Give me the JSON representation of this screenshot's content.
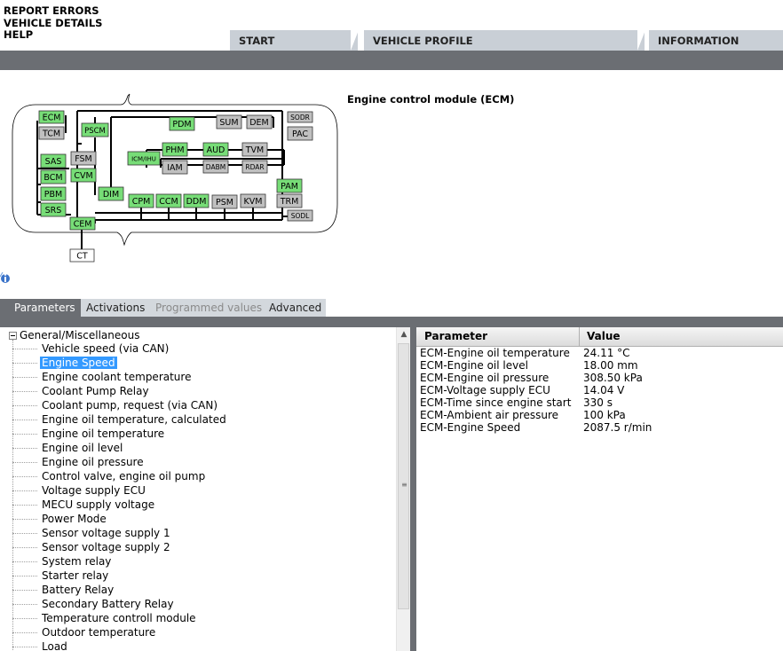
{
  "menu": {
    "report_errors": "REPORT ERRORS",
    "vehicle_details": "VEHICLE DETAILS",
    "help": "HELP"
  },
  "tabs": [
    {
      "label": "START"
    },
    {
      "label": "VEHICLE PROFILE"
    },
    {
      "label": "INFORMATION"
    }
  ],
  "module_title": "Engine control module (ECM)",
  "colors": {
    "green": "#77dd77",
    "gray": "#c0c0c0",
    "navbar": "#6b6e73",
    "tab": "#c9cfd6",
    "selected": "#3399ff"
  },
  "modules": {
    "ecm": "ECM",
    "tcm": "TCM",
    "pscm": "PSCM",
    "pdm": "PDM",
    "sum": "SUM",
    "dem": "DEM",
    "sodr": "SODR",
    "pac": "PAC",
    "icm": "ICM/IHU",
    "phm": "PHM",
    "aud": "AUD",
    "tvm": "TVM",
    "iam": "IAM",
    "dabm": "DABM",
    "rdar": "RDAR",
    "sas": "SAS",
    "fsm": "FSM",
    "bcm": "BCM",
    "cvm": "CVM",
    "pbm": "PBM",
    "srs": "SRS",
    "dim": "DIM",
    "cpm": "CPM",
    "ccm": "CCM",
    "ddm": "DDM",
    "psm": "PSM",
    "kvm": "KVM",
    "pam": "PAM",
    "trm": "TRM",
    "sodl": "SODL",
    "cem": "CEM",
    "ct": "CT"
  },
  "subtabs": [
    {
      "label": "Parameters"
    },
    {
      "label": "Activations"
    },
    {
      "label": "Programmed values"
    },
    {
      "label": "Advanced"
    }
  ],
  "tree": {
    "root": "General/Miscellaneous",
    "items": [
      "Vehicle speed (via CAN)",
      "Engine Speed",
      "Engine coolant temperature",
      "Coolant Pump Relay",
      "Coolant pump, request (via CAN)",
      "Engine oil temperature, calculated",
      "Engine oil temperature",
      "Engine oil level",
      "Engine oil pressure",
      "Control valve, engine oil pump",
      "Voltage supply ECU",
      "MECU supply voltage",
      "Power Mode",
      "Sensor voltage supply 1",
      "Sensor voltage supply 2",
      "System relay",
      "Starter relay",
      "Battery Relay",
      "Secondary Battery Relay",
      "Temperature controll module",
      "Outdoor temperature",
      "Load"
    ]
  },
  "table": {
    "col_parameter": "Parameter",
    "col_value": "Value",
    "rows": [
      {
        "param": "ECM-Engine oil temperature",
        "value": "24.11 °C"
      },
      {
        "param": "ECM-Engine oil level",
        "value": "18.00 mm"
      },
      {
        "param": "ECM-Engine oil pressure",
        "value": "308.50 kPa"
      },
      {
        "param": "ECM-Voltage supply ECU",
        "value": "14.04 V"
      },
      {
        "param": "ECM-Time since engine start",
        "value": "330 s"
      },
      {
        "param": "ECM-Ambient air pressure",
        "value": "100 kPa"
      },
      {
        "param": "ECM-Engine Speed",
        "value": "2087.5 r/min"
      }
    ]
  }
}
